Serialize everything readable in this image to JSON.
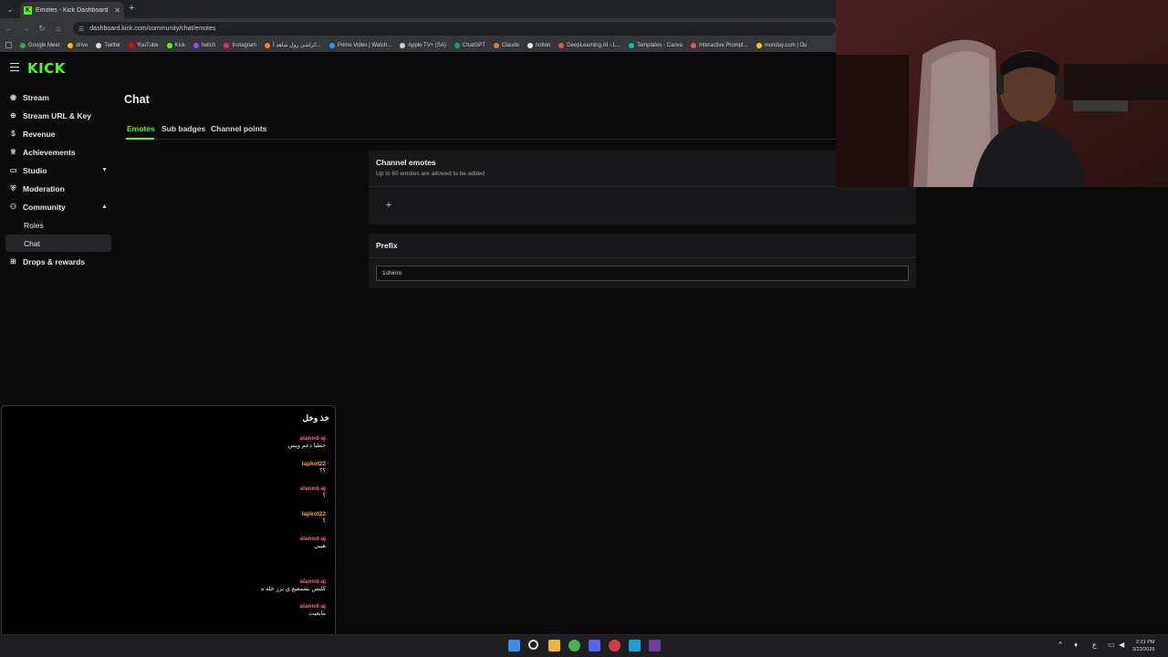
{
  "browser": {
    "tab_title": "Emotes - Kick Dashboard",
    "url": "dashboard.kick.com/community/chat/emotes",
    "bookmarks": [
      "Google Meet",
      "drive",
      "Twitter",
      "YouTube",
      "Kick",
      "twitch",
      "Instagram",
      "كراشي رول شاهد أ...",
      "Prime Video | Watch...",
      "Apple TV+ (SA)",
      "ChatGPT",
      "Claude",
      "notion",
      "DeepLearning.AI - L...",
      "Templates - Canva",
      "Interactive Prompt...",
      "monday.com | Ou"
    ]
  },
  "brand": {
    "logo": "KICK",
    "accent": "#53fc18"
  },
  "sidebar": {
    "items": [
      {
        "label": "Stream",
        "icon": "broadcast-icon"
      },
      {
        "label": "Stream URL & Key",
        "icon": "globe-icon"
      },
      {
        "label": "Revenue",
        "icon": "dollar-icon"
      },
      {
        "label": "Achievements",
        "icon": "trophy-icon"
      },
      {
        "label": "Studio",
        "icon": "monitor-icon"
      },
      {
        "label": "Moderation",
        "icon": "shield-icon"
      },
      {
        "label": "Community",
        "icon": "people-icon"
      },
      {
        "label": "Roles"
      },
      {
        "label": "Chat"
      },
      {
        "label": "Drops & rewards",
        "icon": "gift-icon"
      }
    ]
  },
  "main": {
    "title": "Chat",
    "tabs": [
      "Emotes",
      "Sub badges",
      "Channel points"
    ],
    "emotes_card": {
      "title": "Channel emotes",
      "subtitle": "Up to 60 emotes are allowed to be added",
      "add_label": "+"
    },
    "prefix_card": {
      "title": "Prefix",
      "value": "1shinro"
    }
  },
  "chat_overlay": {
    "title": "خذ وخل",
    "messages": [
      {
        "user": "alanod-aj",
        "text": "حطيا دعم ويس",
        "color": "#ff5e7e"
      },
      {
        "user": "lapkot22",
        "text": "؟؟",
        "color": "#ffa23b"
      },
      {
        "user": "alanod-aj",
        "text": "؟",
        "color": "#ff5e7e"
      },
      {
        "user": "lapkot22",
        "text": "؟",
        "color": "#ffa23b"
      },
      {
        "user": "alanod-aj",
        "text": "هييي",
        "color": "#ff5e7e"
      },
      {
        "user": "alanod-aj",
        "text": "كلنس بشمعيع ي بزر خله ه",
        "color": "#ff5e7e"
      },
      {
        "user": "alanod-aj",
        "text": "مابغيت",
        "color": "#ff5e7e"
      }
    ]
  },
  "taskbar": {
    "time": "2:21 PM",
    "date": "3/23/2026"
  }
}
